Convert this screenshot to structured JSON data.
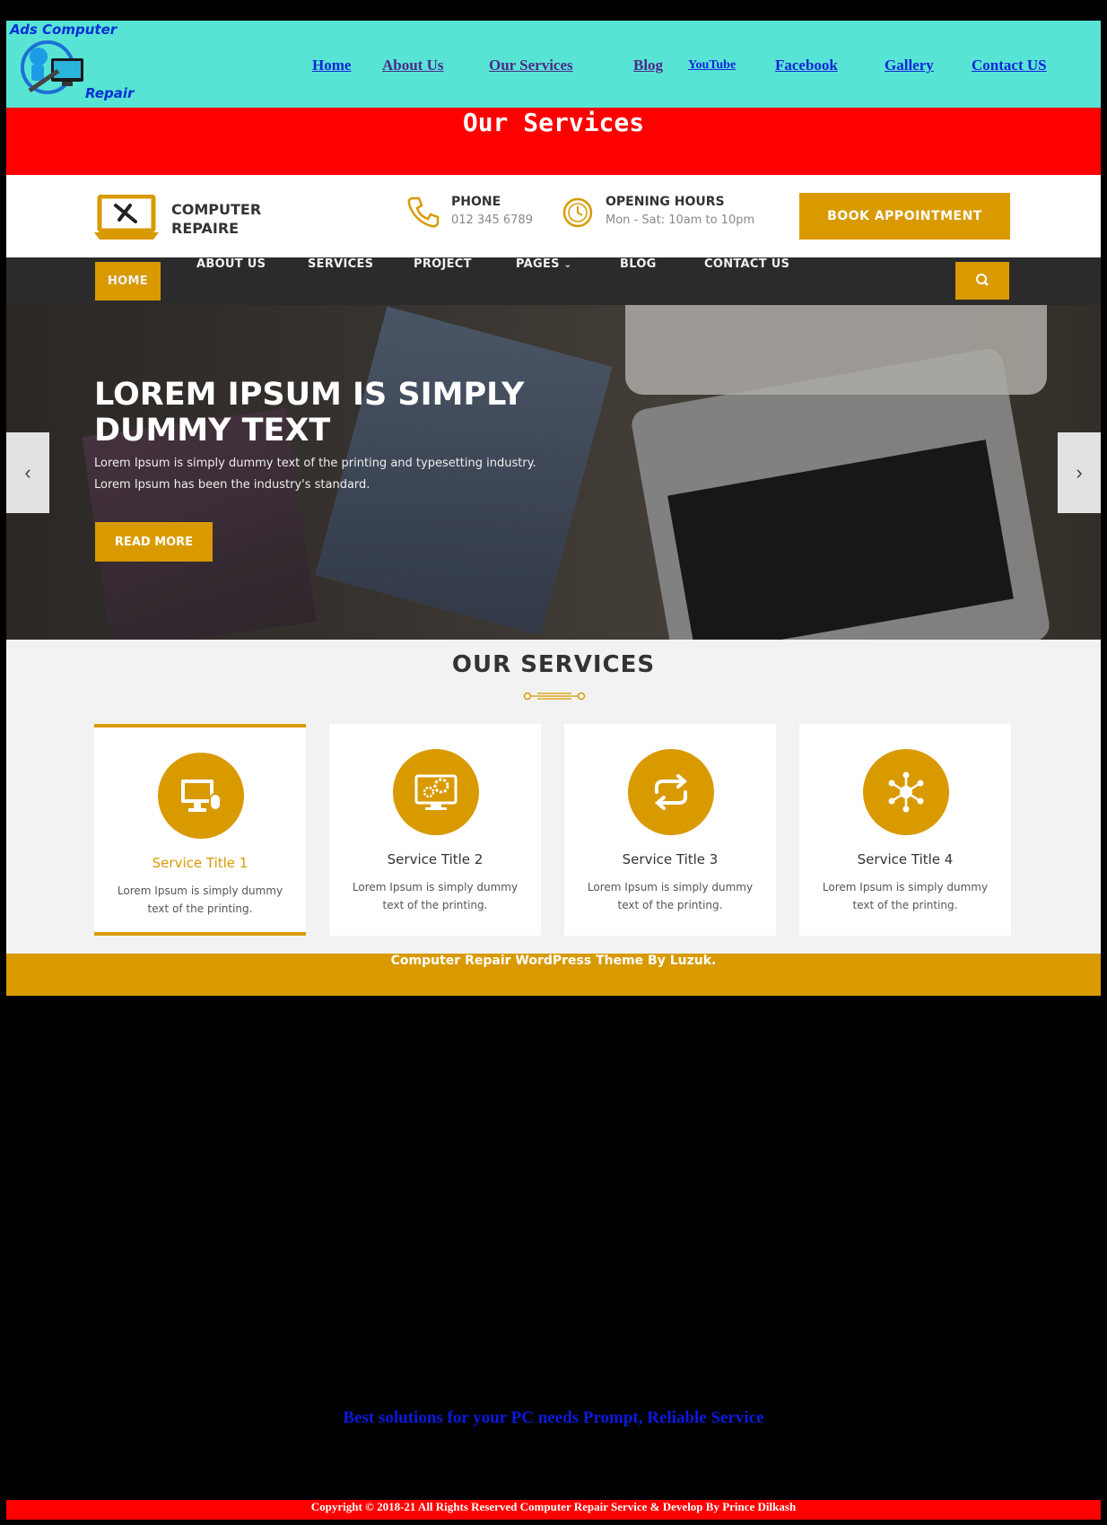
{
  "site_logo": {
    "line1": "Ads Computer",
    "line2": "Repair"
  },
  "topnav": [
    {
      "label": "Home"
    },
    {
      "label": "About Us"
    },
    {
      "label": "Our Services"
    },
    {
      "label": "Blog"
    },
    {
      "label": "YouTube"
    },
    {
      "label": "Facebook"
    },
    {
      "label": "Gallery"
    },
    {
      "label": "Contact US"
    }
  ],
  "page_heading": "Our Services",
  "theme": {
    "brand": {
      "line1": "COMPUTER",
      "line2": "REPAIRE"
    },
    "phone": {
      "title": "PHONE",
      "value": "012 345 6789"
    },
    "hours": {
      "title": "OPENING HOURS",
      "value": "Mon - Sat: 10am to 10pm"
    },
    "book_button": "BOOK APPOINTMENT",
    "menu": [
      "HOME",
      "ABOUT US",
      "SERVICES",
      "PROJECT",
      "PAGES",
      "BLOG",
      "CONTACT US"
    ],
    "hero": {
      "title": "LOREM IPSUM IS SIMPLY DUMMY TEXT",
      "text": "Lorem Ipsum is simply dummy text of the printing and typesetting industry. Lorem Ipsum has been the industry's standard.",
      "button": "READ MORE"
    },
    "services_heading": "OUR SERVICES",
    "services": [
      {
        "title": "Service Title 1",
        "desc": "Lorem Ipsum is simply dummy text of the printing."
      },
      {
        "title": "Service Title 2",
        "desc": "Lorem Ipsum is simply dummy text of the printing."
      },
      {
        "title": "Service Title 3",
        "desc": "Lorem Ipsum is simply dummy text of the printing."
      },
      {
        "title": "Service Title 4",
        "desc": "Lorem Ipsum is simply dummy text of the printing."
      }
    ],
    "footer": "Computer Repair WordPress Theme By Luzuk."
  },
  "tagline": "Best solutions for your PC needs Prompt, Reliable Service",
  "copyright": "Copyright © 2018-21 All Rights Reserved Computer Repair Service & Develop By Prince Dilkash",
  "colors": {
    "nav_bg": "#57e4d5",
    "banner_red": "#ff0000",
    "accent_gold": "#d99a00",
    "link_blue": "#1525d8"
  }
}
